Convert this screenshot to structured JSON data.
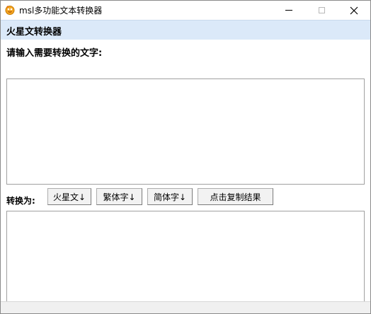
{
  "window": {
    "title": "msl多功能文本转换器",
    "icon": "msl-app-icon"
  },
  "controls": {
    "minimize_icon": "minimize-icon",
    "maximize_icon": "maximize-icon",
    "close_icon": "close-icon"
  },
  "header": {
    "title": "火星文转换器"
  },
  "input": {
    "label": "请输入需要转换的文字:",
    "value": ""
  },
  "convert": {
    "label": "转换为:",
    "buttons": [
      {
        "label": "火星文↓"
      },
      {
        "label": "繁体字↓"
      },
      {
        "label": "简体字↓"
      },
      {
        "label": "点击复制结果"
      }
    ]
  },
  "output": {
    "value": ""
  },
  "colors": {
    "header_bg": "#dbe9f9",
    "window_bg": "#ffffff",
    "button_bg": "#f2f2f2"
  }
}
